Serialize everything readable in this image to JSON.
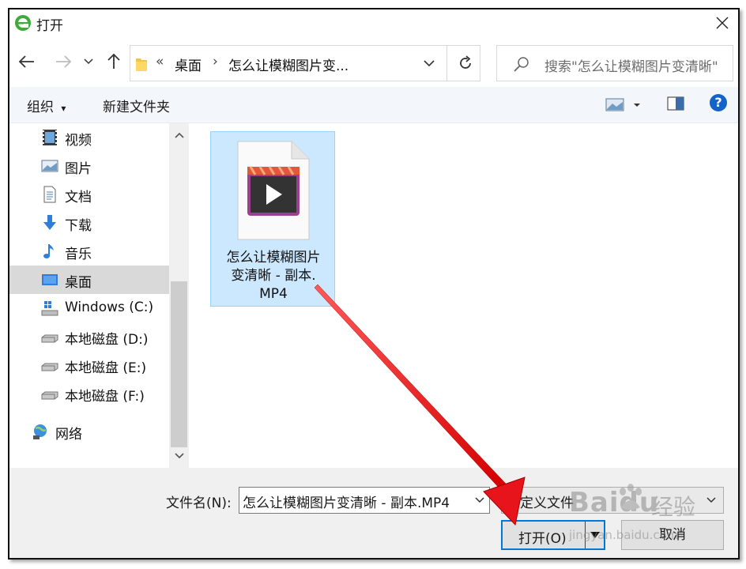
{
  "window": {
    "title": "打开",
    "close_symbol": "✕"
  },
  "address": {
    "overflow": "«",
    "segments": [
      "桌面",
      "怎么让模糊图片变..."
    ],
    "separator": "›"
  },
  "search": {
    "placeholder": "搜索\"怎么让模糊图片变清晰\""
  },
  "toolbar": {
    "organize_label": "组织",
    "organize_arrow": "▾",
    "new_folder_label": "新建文件夹",
    "help_label": "?"
  },
  "sidebar": {
    "items": [
      {
        "label": "视频",
        "icon": "video-icon"
      },
      {
        "label": "图片",
        "icon": "pictures-icon"
      },
      {
        "label": "文档",
        "icon": "documents-icon"
      },
      {
        "label": "下载",
        "icon": "download-icon"
      },
      {
        "label": "音乐",
        "icon": "music-icon"
      },
      {
        "label": "桌面",
        "icon": "desktop-icon",
        "selected": true
      },
      {
        "label": "Windows (C:)",
        "icon": "windows-drive-icon"
      },
      {
        "label": "本地磁盘 (D:)",
        "icon": "drive-icon"
      },
      {
        "label": "本地磁盘 (E:)",
        "icon": "drive-icon"
      },
      {
        "label": "本地磁盘 (F:)",
        "icon": "drive-icon"
      },
      {
        "label": "网络",
        "icon": "network-icon"
      }
    ]
  },
  "files": [
    {
      "name_line1": "怎么让模糊图片",
      "name_line2": "变清晰 - 副本.",
      "name_line3": "MP4",
      "icon": "video-file-icon",
      "selected": true
    }
  ],
  "bottom": {
    "filename_label": "文件名(N):",
    "filename_value": "怎么让模糊图片变清晰 - 副本.MP4",
    "filetype_value": "自定义文件",
    "open_label": "打开(O)",
    "cancel_label": "取消"
  },
  "watermark": {
    "brand": "Baidu",
    "brand_suffix": "经验",
    "url": "jingyan.baidu.com"
  },
  "colors": {
    "accent": "#0078d7",
    "selection": "#cce8ff",
    "annotation_arrow": "#e8141b"
  }
}
